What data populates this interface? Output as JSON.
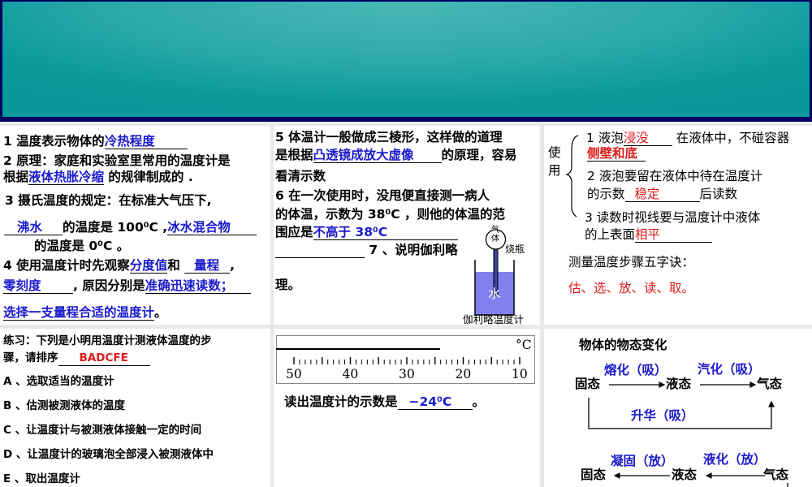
{
  "colors": {
    "header_border": "#00005e",
    "header_teal": "#2aa8a9",
    "answer_blue": "#1a1acc",
    "answer_red": "#e01a1a",
    "water": "#8080ee"
  },
  "p1": {
    "l1": "1 温度表示物体的",
    "a1": "冷热程度",
    "l2": "2 原理：家庭和实验室里常用的温度计是",
    "l3a": "根据",
    "a2": "液体热胀冷缩",
    "l3b": " 的规律制成的 .",
    "l4": "3 摄氏温度的规定：在标准大气压下,",
    "a3": "沸水",
    "l5": "的温度是 100⁰C ,",
    "a4": "冰水混合物",
    "l6": "的温度是 0⁰C 。",
    "l7": "4 使用温度计时先观察",
    "a5": "分度值",
    "l7b": "和",
    "a6": "量程",
    "l7c": ",",
    "a7": "零刻度",
    "l8": ", 原因分别是",
    "a8": "准确迅速读数；",
    "a9": "选择一支量程合适的温度计",
    "l9": "。"
  },
  "p2": {
    "l1": "5 体温计一般做成三棱形，这样做的道理",
    "l2a": "是根据",
    "a1": "凸透镜成放大虚像",
    "l2b": "的原理，容易",
    "l3": "看清示数",
    "l4": "6 在一次使用时，没甩便直接测一病人",
    "l5": "的体温，示数为 38⁰C ，则他的体温的范",
    "l6": "围应是",
    "a2": "不高于 38⁰C",
    "l7": "7 、说明伽利略",
    "l8": "理。",
    "fig_gas": "气体",
    "fig_flask": "烧瓶",
    "fig_water": "水",
    "fig_caption": "伽利略温度计"
  },
  "p3": {
    "side": "使用",
    "l1a": "1  液泡",
    "a1": "浸没",
    "l1b": "在液体中，不碰容器",
    "a2": "侧壁和底",
    "l2": "2  液泡要留在液体中待在温度计",
    "l3a": "的示数",
    "a3": "稳定",
    "l3b": "后读数",
    "l4": "3   读数时视线要与温度计中液体",
    "l5": "的上表面",
    "a4": "相平",
    "l6": "测量温度步骤五字诀：",
    "l7": "估、选、放、读、取。"
  },
  "p4": {
    "q1": "练习：下列是小明用温度计测液体温度的步",
    "q2": "骤，请排序",
    "ans": "BADCFE",
    "items": [
      "A 、选取适当的温度计",
      "B 、估测被测液体的温度",
      "C 、让温度计与被测液体接触一定的时间",
      "D 、让温度计的玻璃泡全部浸入被测液体中",
      "E 、取出温度计"
    ]
  },
  "p5": {
    "unit": "°C",
    "ticks": [
      "50",
      "40",
      "30",
      "20",
      "10"
    ],
    "q": "读出温度计的示数是",
    "ans": "−24⁰C",
    "end": "。"
  },
  "p6": {
    "title": "物体的物态变化",
    "solid": "固态",
    "liquid": "液态",
    "gas": "气态",
    "melt": "熔化（吸）",
    "vapor": "汽化（吸）",
    "sublime": "升华（吸）",
    "freeze": "凝固（放）",
    "condense": "液化（放）"
  }
}
